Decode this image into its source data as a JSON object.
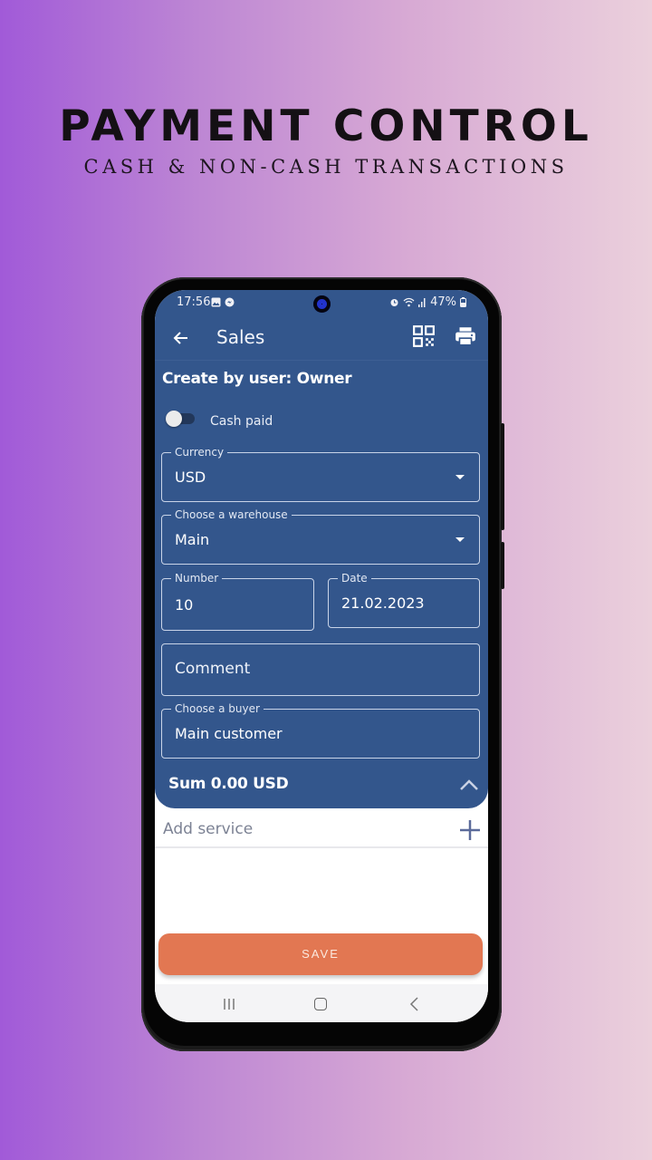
{
  "promo": {
    "headline": "PAYMENT CONTROL",
    "subheadline": "CASH & NON-CASH TRANSACTIONS"
  },
  "statusbar": {
    "time": "17:56",
    "battery": "47%",
    "left_icons": [
      "gallery-icon",
      "messenger-icon"
    ],
    "right_icons": [
      "alarm-icon",
      "wifi-icon",
      "signal-icon",
      "battery-icon"
    ]
  },
  "appbar": {
    "title": "Sales",
    "back_icon": "arrow-left-icon",
    "actions": [
      "qr-code-icon",
      "printer-icon"
    ]
  },
  "form": {
    "creator": "Create by user: Owner",
    "cash_paid": {
      "label": "Cash paid",
      "checked": false
    },
    "currency": {
      "label": "Currency",
      "value": "USD"
    },
    "warehouse": {
      "label": "Choose a warehouse",
      "value": "Main"
    },
    "number": {
      "label": "Number",
      "value": "10"
    },
    "date": {
      "label": "Date",
      "value": "21.02.2023"
    },
    "comment": {
      "placeholder": "Comment"
    },
    "buyer": {
      "label": "Choose a buyer",
      "value": "Main customer"
    },
    "sum": "Sum 0.00 USD"
  },
  "services": {
    "add_label": "Add service"
  },
  "save_label": "SAVE",
  "colors": {
    "primary": "#33568c",
    "accent": "#e27752"
  }
}
